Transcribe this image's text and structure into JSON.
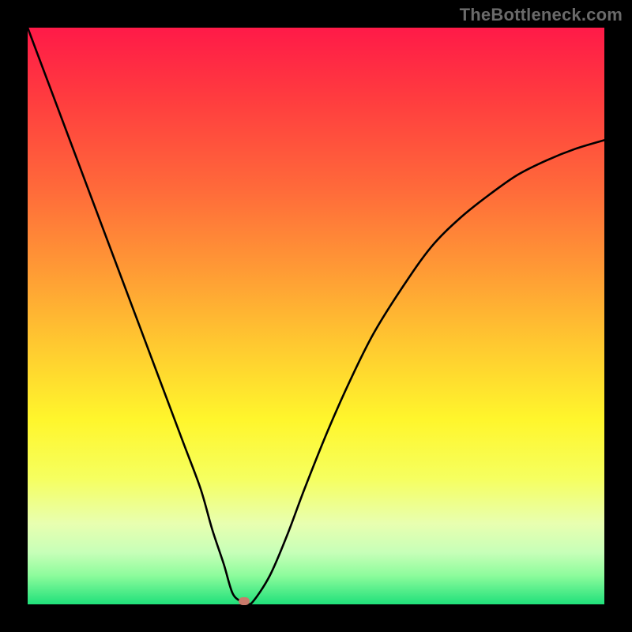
{
  "watermark": "TheBottleneck.com",
  "chart_data": {
    "type": "line",
    "title": "",
    "xlabel": "",
    "ylabel": "",
    "xlim": [
      0,
      100
    ],
    "ylim": [
      0,
      100
    ],
    "background_gradient": {
      "top_color": "#ff1a48",
      "bottom_color": "#1fe07a",
      "stops": [
        {
          "pos": 0,
          "color": "#ff1a48"
        },
        {
          "pos": 12,
          "color": "#ff3b3f"
        },
        {
          "pos": 28,
          "color": "#ff6a3a"
        },
        {
          "pos": 42,
          "color": "#ff9a35"
        },
        {
          "pos": 55,
          "color": "#ffc930"
        },
        {
          "pos": 68,
          "color": "#fff62c"
        },
        {
          "pos": 78,
          "color": "#f6ff5e"
        },
        {
          "pos": 86,
          "color": "#e8ffb0"
        },
        {
          "pos": 91,
          "color": "#c7ffb8"
        },
        {
          "pos": 95,
          "color": "#8dfc9c"
        },
        {
          "pos": 100,
          "color": "#1fe07a"
        }
      ]
    },
    "series": [
      {
        "name": "bottleneck-curve",
        "color": "#000000",
        "x": [
          0,
          3,
          6,
          9,
          12,
          15,
          18,
          21,
          24,
          27,
          30,
          32,
          34,
          35.5,
          37,
          38,
          39,
          42,
          45,
          48,
          52,
          56,
          60,
          65,
          70,
          75,
          80,
          85,
          90,
          95,
          100
        ],
        "y": [
          100,
          92,
          84,
          76,
          68,
          60,
          52,
          44,
          36,
          28,
          20,
          13,
          7,
          2,
          0.5,
          0.3,
          0.4,
          5,
          12,
          20,
          30,
          39,
          47,
          55,
          62,
          67,
          71,
          74.5,
          77,
          79,
          80.5
        ]
      }
    ],
    "marker": {
      "name": "optimal-point",
      "x": 37.5,
      "y": 0.5,
      "color": "#c97a6b"
    }
  }
}
